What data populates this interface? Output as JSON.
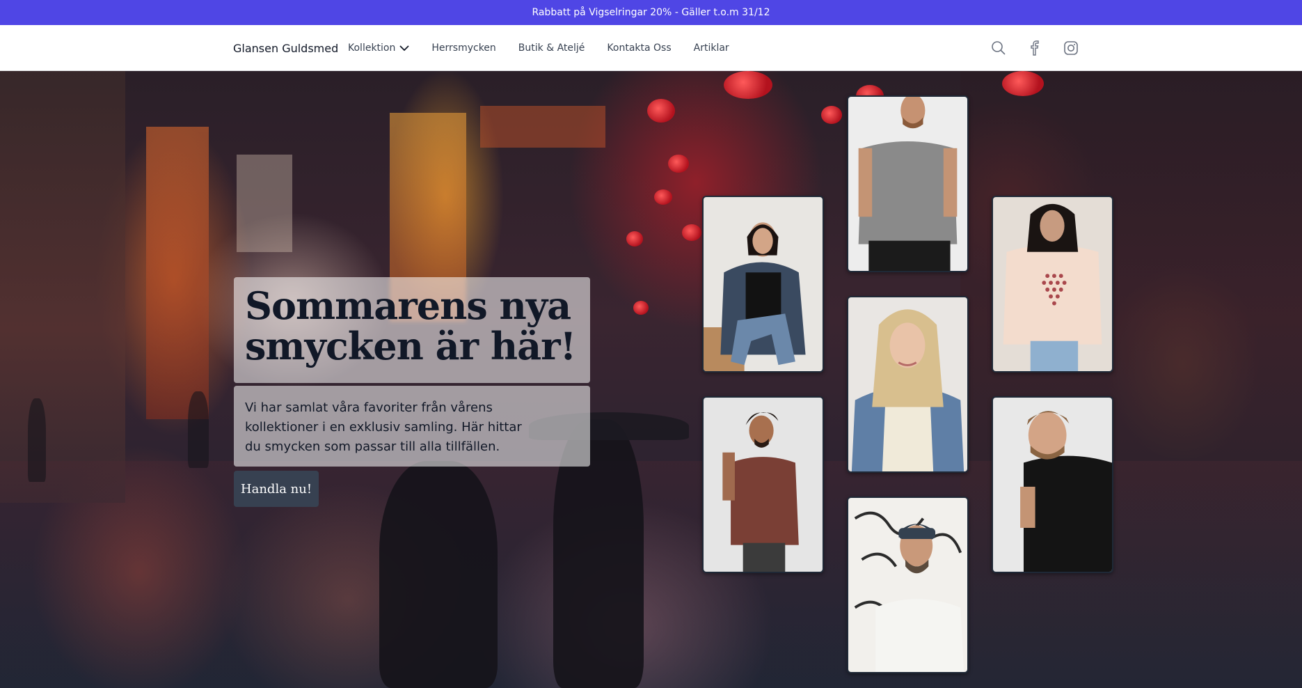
{
  "announcement": {
    "text": "Rabbatt på Vigselringar 20% - Gäller t.o.m 31/12"
  },
  "header": {
    "brand": "Glansen Guldsmed",
    "nav": [
      {
        "label": "Kollektion",
        "has_dropdown": true
      },
      {
        "label": "Herrsmycken"
      },
      {
        "label": "Butik & Ateljé"
      },
      {
        "label": "Kontakta Oss"
      },
      {
        "label": "Artiklar"
      }
    ],
    "icons": [
      "search-icon",
      "facebook-icon",
      "instagram-icon"
    ]
  },
  "hero": {
    "headline_line1": "Sommarens nya",
    "headline_line2": "smycken är här!",
    "subtext": "Vi har samlat våra favoriter från vårens kollektioner i en exklusiv samling. Här hittar du smycken som passar till alla tillfällen.",
    "cta_label": "Handla nu!"
  },
  "gallery": [
    {
      "id": "woman-denim-jacket-black-tee"
    },
    {
      "id": "man-grey-tee"
    },
    {
      "id": "woman-peach-tee"
    },
    {
      "id": "man-brown-tee-curly-hair"
    },
    {
      "id": "woman-blonde-denim-jacket"
    },
    {
      "id": "man-black-tee"
    },
    {
      "id": "man-beanie-white-tee"
    }
  ],
  "colors": {
    "announcement_bg": "#4f46e5",
    "cta_bg": "#374151",
    "text_dark": "#111827"
  }
}
